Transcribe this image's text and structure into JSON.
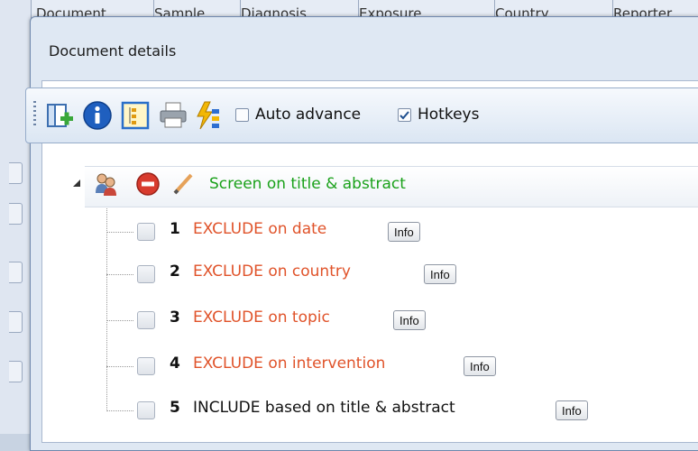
{
  "background_window": {
    "columns": [
      "Document",
      "Sample",
      "Diagnosis",
      "Exposure",
      "Country",
      "Reporter"
    ]
  },
  "dialog": {
    "title": "Document details"
  },
  "toolbar": {
    "icons": [
      "add-item-icon",
      "info-icon",
      "tree-view-icon",
      "print-icon",
      "auto-code-icon"
    ],
    "auto_advance_label": "Auto advance",
    "auto_advance_checked": false,
    "hotkeys_label": "Hotkeys",
    "hotkeys_checked": true
  },
  "tree": {
    "root_label": "Screen on title & abstract",
    "root_color": "#1aa11a",
    "exclude_color": "#e0532a",
    "items": [
      {
        "number": "1",
        "label": "EXCLUDE on date",
        "info_label": "Info"
      },
      {
        "number": "2",
        "label": "EXCLUDE on country",
        "info_label": "Info"
      },
      {
        "number": "3",
        "label": "EXCLUDE on topic",
        "info_label": "Info"
      },
      {
        "number": "4",
        "label": "EXCLUDE on intervention",
        "info_label": "Info"
      },
      {
        "number": "5",
        "label": "INCLUDE based on title & abstract",
        "info_label": "Info"
      }
    ]
  }
}
